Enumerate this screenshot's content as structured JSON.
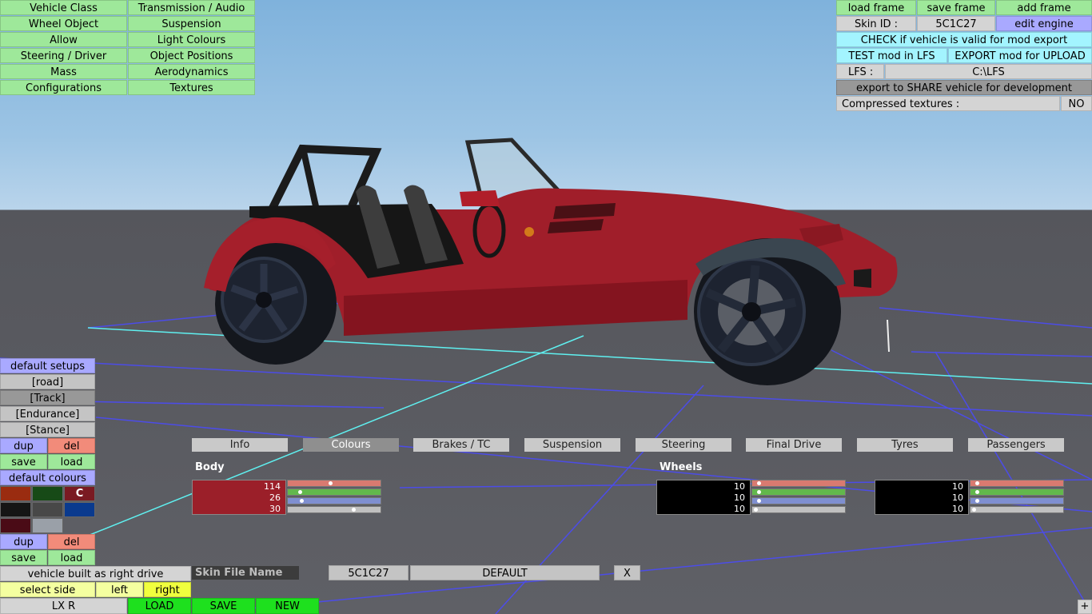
{
  "left_menu": [
    "Vehicle Class",
    "Transmission / Audio",
    "Wheel Object",
    "Suspension",
    "Allow",
    "Light Colours",
    "Steering / Driver",
    "Object Positions",
    "Mass",
    "Aerodynamics",
    "Configurations",
    "Textures"
  ],
  "top_right": {
    "load_frame": "load frame",
    "save_frame": "save frame",
    "add_frame": "add frame",
    "skin_id_label": "Skin ID :",
    "skin_id_value": "5C1C27",
    "edit_engine": "edit engine",
    "check_valid": "CHECK if vehicle is valid for mod export",
    "test_mod": "TEST mod in LFS",
    "export_mod": "EXPORT mod for UPLOAD",
    "lfs_label": "LFS :",
    "lfs_path": "C:\\LFS",
    "export_share": "export to SHARE vehicle for development",
    "compressed_label": "Compressed textures :",
    "compressed_value": "NO"
  },
  "setups": {
    "header": "default setups",
    "items": [
      "[road]",
      "[Track]",
      "[Endurance]",
      "[Stance]"
    ],
    "dup": "dup",
    "del": "del",
    "save": "save",
    "load": "load"
  },
  "colours": {
    "header": "default colours",
    "selected_letter": "C",
    "swatches": [
      "#9a2c10",
      "#174a17",
      "#7a1a22",
      "#151515",
      "#484848",
      "#0a3a8e",
      "#4a0b16",
      "#9aa0a8"
    ],
    "dup": "dup",
    "del": "del",
    "save": "save",
    "load": "load"
  },
  "bottom_left": {
    "right_drive": "vehicle built as right drive",
    "select_side": "select side",
    "left": "left",
    "right": "right",
    "config_name": "LX R",
    "load": "LOAD",
    "save": "SAVE",
    "new": "NEW"
  },
  "tabs": [
    "Info",
    "Colours",
    "Brakes / TC",
    "Suspension",
    "Steering",
    "Final Drive",
    "Tyres",
    "Passengers"
  ],
  "active_tab": "Colours",
  "body_colour": {
    "label": "Body",
    "color": "#9b1f29",
    "r": "114",
    "g": "26",
    "b": "30",
    "r_level": 0.45,
    "g_level": 0.1,
    "b_level": 0.12
  },
  "wheels_colour": {
    "label": "Wheels",
    "color": "#000000",
    "r": "10",
    "g": "10",
    "b": "10",
    "r_level": 0.04,
    "g_level": 0.04,
    "b_level": 0.04
  },
  "wheels_colour_2": {
    "color": "#000000",
    "r": "10",
    "g": "10",
    "b": "10",
    "r_level": 0.04,
    "g_level": 0.04,
    "b_level": 0.04
  },
  "skin": {
    "file_name_placeholder": "Skin File Name",
    "id": "5C1C27",
    "default": "DEFAULT",
    "close": "X"
  },
  "corner_plus": "+",
  "colors": {
    "menu_green": "#9ee89a",
    "accent_cyan": "#a3f4ff",
    "accent_violet": "#a9a9ff",
    "body_red": "#9b1f29"
  }
}
